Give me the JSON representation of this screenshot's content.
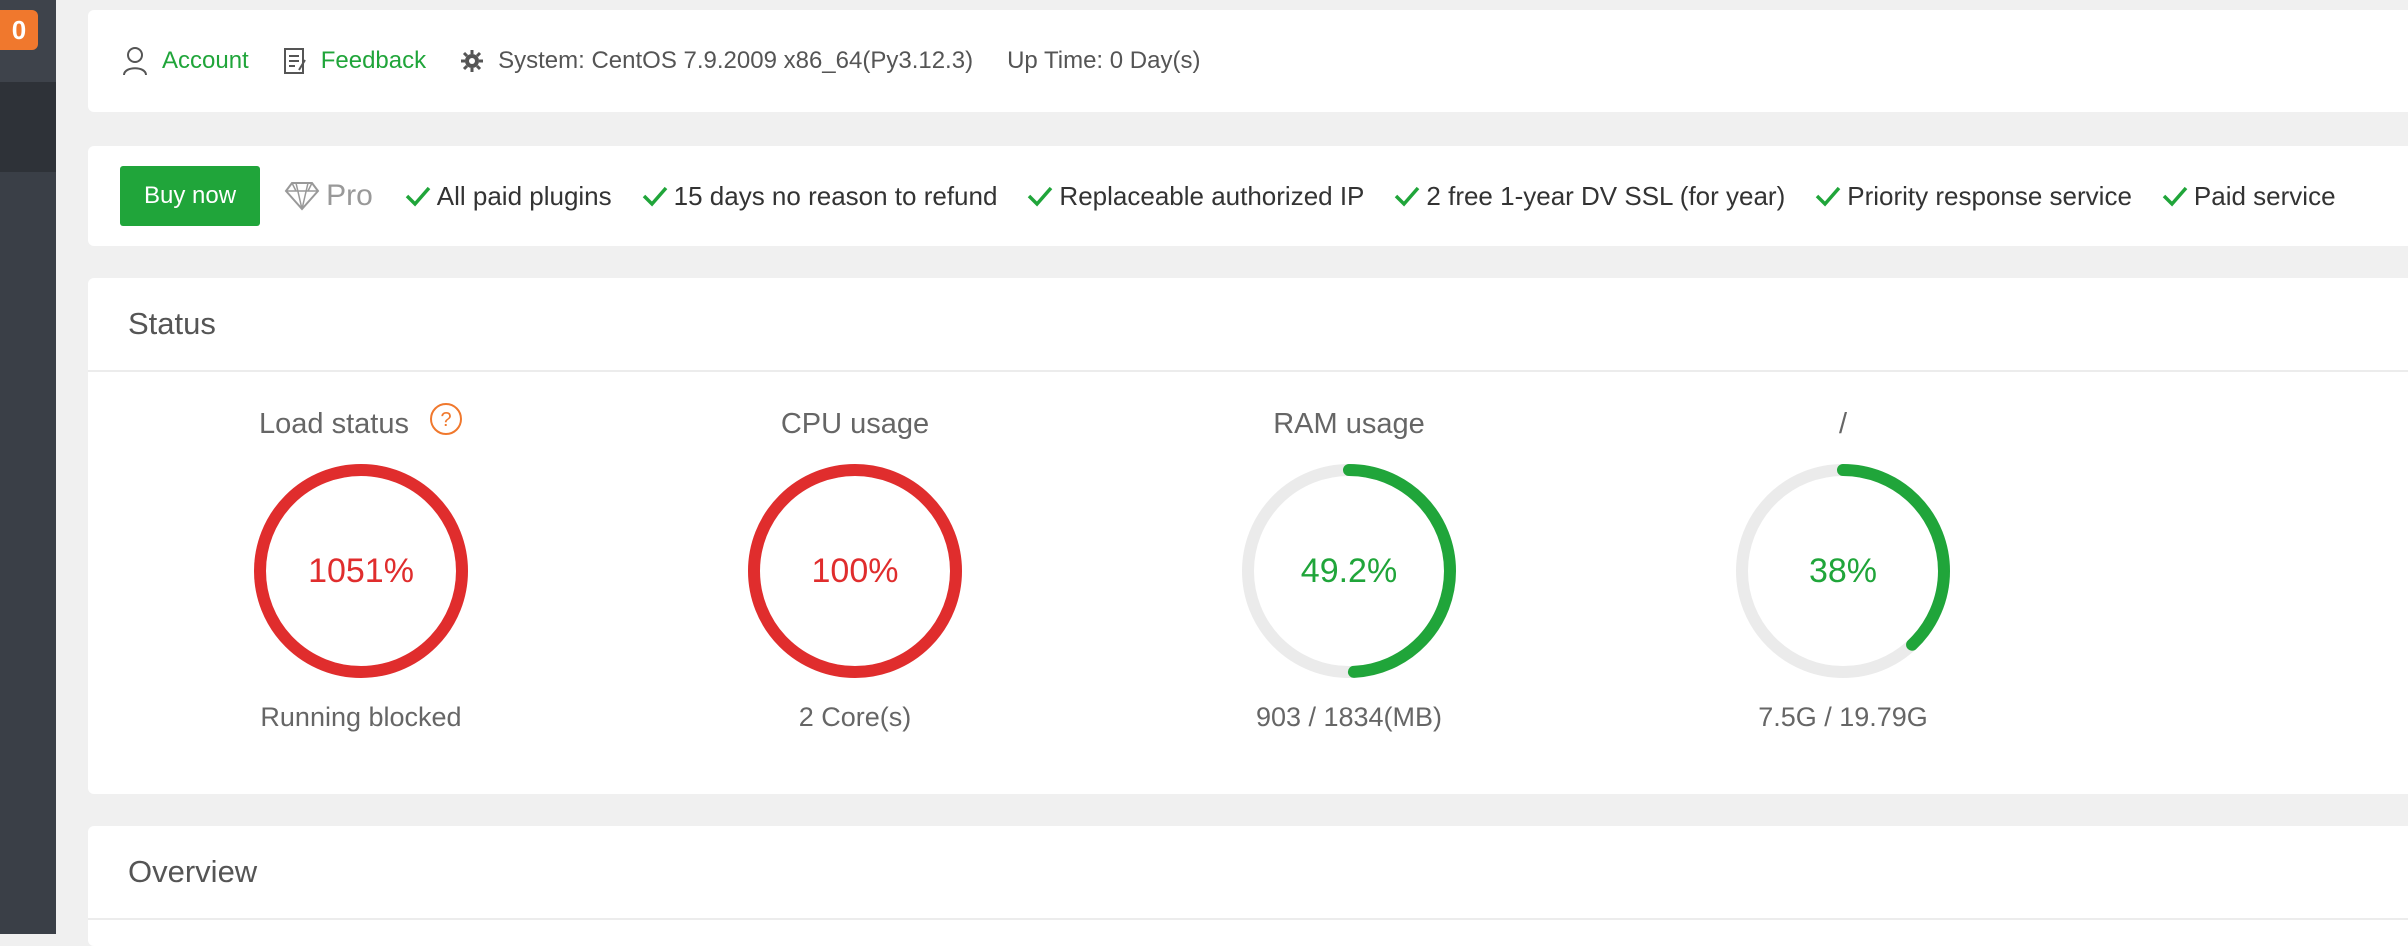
{
  "sidebar": {
    "badge": "0"
  },
  "topbar": {
    "account": "Account",
    "feedback": "Feedback",
    "system": "System: CentOS 7.9.2009 x86_64(Py3.12.3)",
    "uptime": "Up Time: 0 Day(s)"
  },
  "probar": {
    "buy_label": "Buy now",
    "pro_label": "Pro",
    "features": [
      "All paid plugins",
      "15 days no reason to refund",
      "Replaceable authorized IP",
      "2 free 1-year DV SSL (for year)",
      "Priority response service",
      "Paid service"
    ]
  },
  "status": {
    "title": "Status",
    "gauges": [
      {
        "title": "Load status",
        "value": "1051%",
        "fraction": 1.0,
        "sub": "Running blocked",
        "color": "#e02d2d",
        "help": true
      },
      {
        "title": "CPU usage",
        "value": "100%",
        "fraction": 1.0,
        "sub": "2 Core(s)",
        "color": "#e02d2d",
        "help": false
      },
      {
        "title": "RAM usage",
        "value": "49.2%",
        "fraction": 0.492,
        "sub": "903 / 1834(MB)",
        "color": "#20a53a",
        "help": false
      },
      {
        "title": "/",
        "value": "38%",
        "fraction": 0.38,
        "sub": "7.5G / 19.79G",
        "color": "#20a53a",
        "help": false
      }
    ]
  },
  "overview": {
    "title": "Overview"
  },
  "colors": {
    "accent": "#20a53a",
    "danger": "#e02d2d",
    "badge": "#f0782d",
    "track": "#ebebeb"
  }
}
